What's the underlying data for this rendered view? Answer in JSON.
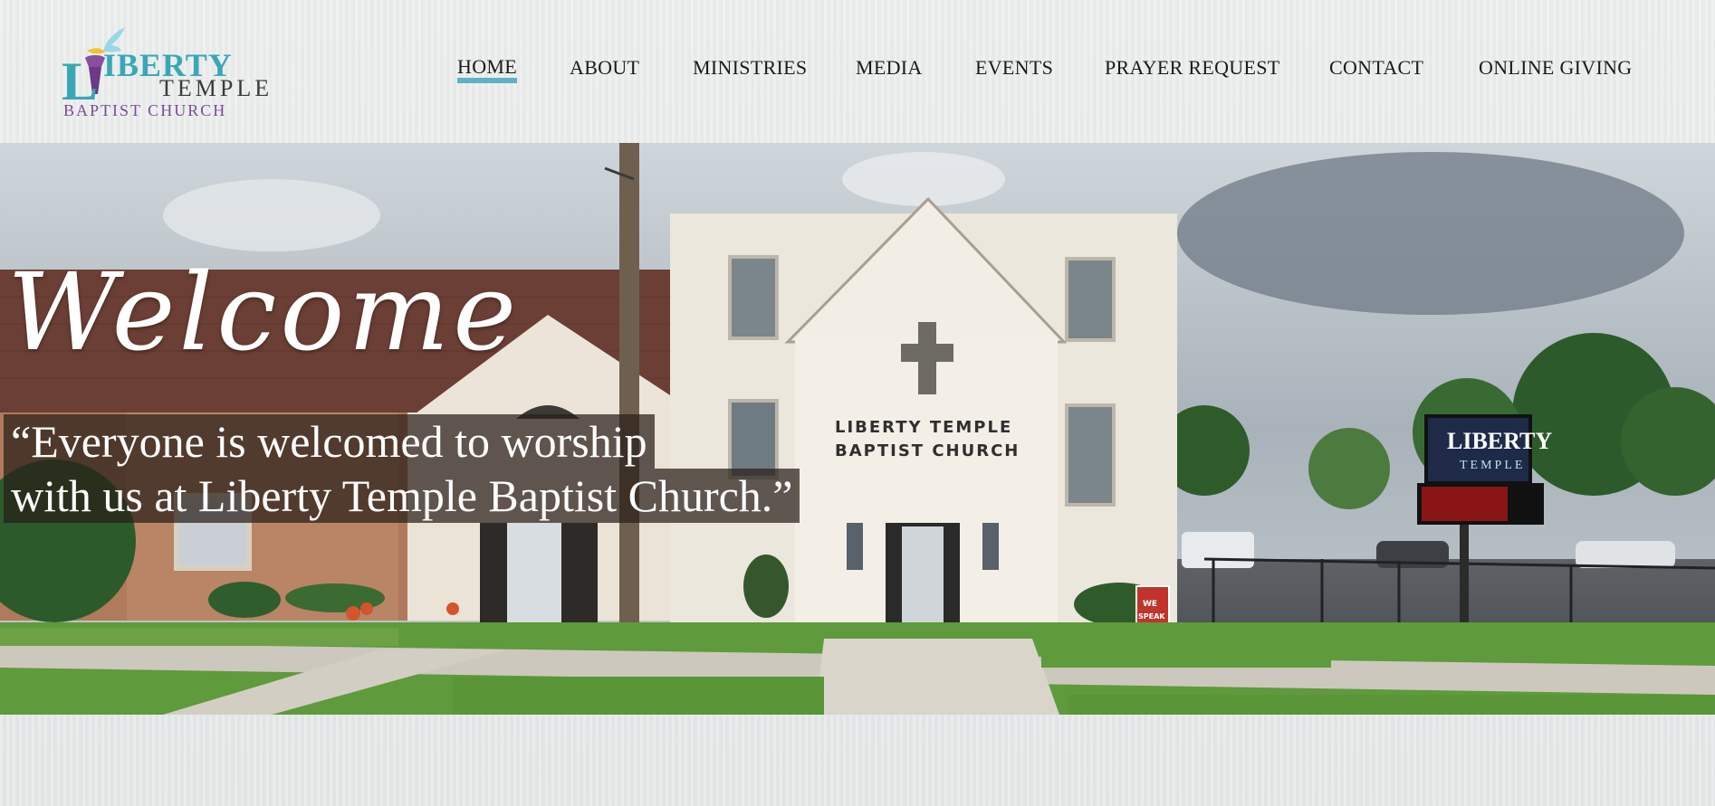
{
  "logo": {
    "word1": "IBERTY",
    "initial": "L",
    "word2": "TEMPLE",
    "word3": "BAPTIST CHURCH"
  },
  "nav": {
    "items": [
      "HOME",
      "ABOUT",
      "MINISTRIES",
      "MEDIA",
      "EVENTS",
      "PRAYER REQUEST",
      "CONTACT",
      "ONLINE GIVING"
    ],
    "active_index": 0
  },
  "hero": {
    "welcome": "Welcome",
    "quote_line1": "“Everyone is welcomed to worship",
    "quote_line2": "with us at Liberty Temple Baptist Church.”",
    "building_sign_line1": "LIBERTY TEMPLE",
    "building_sign_line2": "BAPTIST CHURCH",
    "street_sign_title": "LIBERTY",
    "street_sign_sub": "TEMPLE",
    "yard_sign": "WE SPEAK UP!"
  },
  "colors": {
    "accent": "#5fb2c3",
    "logo_teal": "#3aa7b7",
    "logo_purple": "#7a4c96",
    "nav_text": "#1a1a1a"
  }
}
